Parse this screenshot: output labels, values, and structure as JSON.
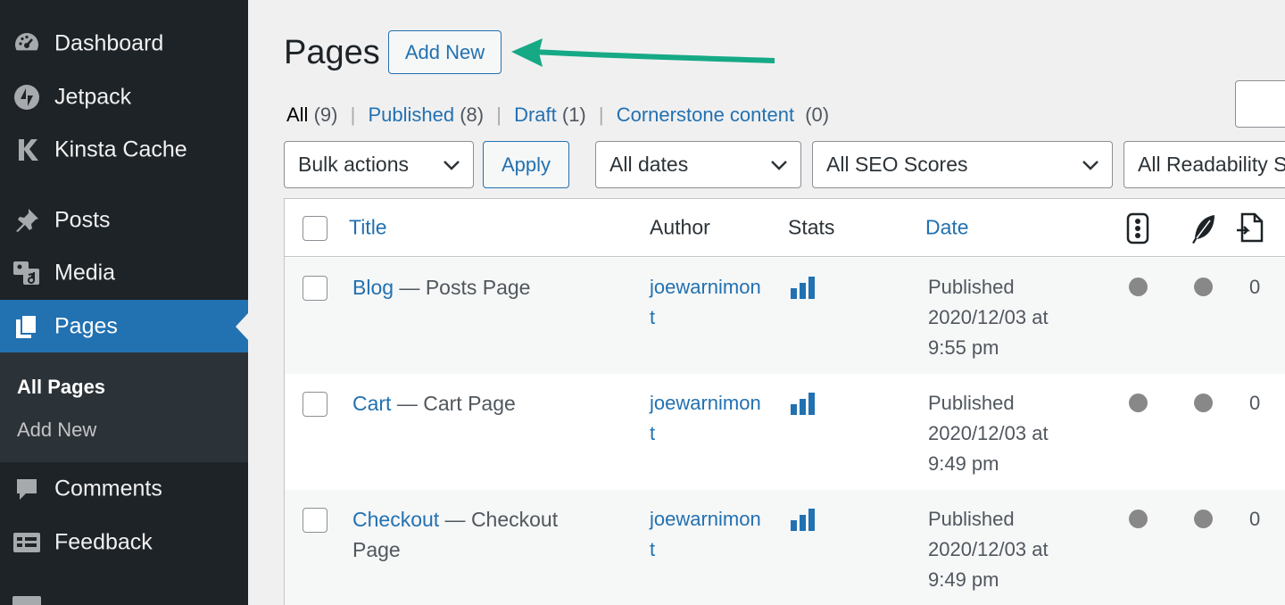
{
  "sidebar": {
    "items": [
      {
        "label": "Dashboard",
        "icon": "dashboard-icon"
      },
      {
        "label": "Jetpack",
        "icon": "jetpack-icon"
      },
      {
        "label": "Kinsta Cache",
        "icon": "kinsta-icon"
      },
      {
        "label": "Posts",
        "icon": "pin-icon"
      },
      {
        "label": "Media",
        "icon": "media-icon"
      },
      {
        "label": "Pages",
        "icon": "pages-icon"
      },
      {
        "label": "Comments",
        "icon": "comment-icon"
      },
      {
        "label": "Feedback",
        "icon": "feedback-icon"
      }
    ],
    "submenu": [
      "All Pages",
      "Add New"
    ]
  },
  "header": {
    "title": "Pages",
    "add_new": "Add New"
  },
  "filters": {
    "links": [
      {
        "label": "All",
        "count": "(9)"
      },
      {
        "label": "Published",
        "count": "(8)"
      },
      {
        "label": "Draft",
        "count": "(1)"
      },
      {
        "label": "Cornerstone content",
        "count": "(0)"
      }
    ],
    "separator": "|",
    "bulk_actions": "Bulk actions",
    "apply": "Apply",
    "dates": "All dates",
    "seo": "All SEO Scores",
    "readability": "All Readability Scores"
  },
  "table": {
    "columns": {
      "title": "Title",
      "author": "Author",
      "stats": "Stats",
      "date": "Date"
    },
    "rows": [
      {
        "title": "Blog",
        "state": " — Posts Page",
        "author": "joewarnimont",
        "status": "Published",
        "date": "2020/12/03 at",
        "time": "9:55 pm",
        "count": "0"
      },
      {
        "title": "Cart",
        "state": " — Cart Page",
        "author": "joewarnimont",
        "status": "Published",
        "date": "2020/12/03 at",
        "time": "9:49 pm",
        "count": "0"
      },
      {
        "title": "Checkout",
        "state": " — Checkout Page",
        "author": "joewarnimont",
        "status": "Published",
        "date": "2020/12/03 at",
        "time": "9:49 pm",
        "count": "0"
      }
    ]
  },
  "colors": {
    "sidebar_bg": "#1d2327",
    "accent": "#2271b1",
    "annotation_arrow": "#16a985",
    "score_dot": "#888888"
  }
}
